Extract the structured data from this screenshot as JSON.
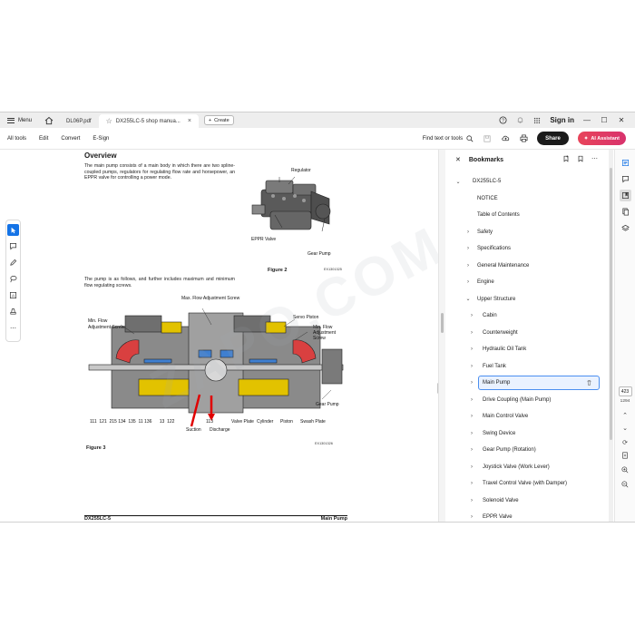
{
  "titlebar": {
    "menu_label": "Menu",
    "tabs": [
      {
        "label": "DL06P.pdf"
      },
      {
        "label": "DX255LC-5 shop manua...",
        "close": "×"
      }
    ],
    "create_label": "Create",
    "sign_in": "Sign in"
  },
  "toolbar": {
    "items": [
      "All tools",
      "Edit",
      "Convert",
      "E-Sign"
    ],
    "find_label": "Find text or tools",
    "share_label": "Share",
    "ai_label": "AI Assistant"
  },
  "document": {
    "title": "Overview",
    "overview_text": "The main pump consists of a main body in which there are two spline-coupled pumps, regulators for regulating flow rate and horsepower, an EPPR valve for controlling a power mode.",
    "pump_text": "The pump is as follows, and further includes maximum and minimum flow regulating screws.",
    "fig2": {
      "regulator": "Regulator",
      "eppr_valve": "EPPR Valve",
      "gear_pump": "Gear Pump",
      "caption": "Figure 2",
      "code": "EX1301325"
    },
    "fig3": {
      "max_flow": "Max. Flow Adjustment Screw",
      "min_flow_left_1": "Min. Flow",
      "min_flow_left_2": "Adjustment Screw",
      "servo_piston": "Servo Piston",
      "min_flow_right_1": "Min. Flow",
      "min_flow_right_2": "Adjustment",
      "min_flow_right_3": "Screw",
      "gear_pump": "Gear Pump",
      "numbers": "111  121  215 134  135  11 136      13  122",
      "num_113": "113",
      "valve_plate": "Valve Plate",
      "cylinder": "Cylinder",
      "piston": "Piston",
      "swash_plate": "Swash Plate",
      "suction": "Suction",
      "discharge": "Discharge",
      "caption": "Figure 3",
      "code": "EX1301326"
    },
    "footer_left": "DX255LC-5",
    "footer_right": "Main Pump",
    "watermark": "ZAPO.COM"
  },
  "bookmarks": {
    "header": "Bookmarks",
    "items": [
      {
        "label": "DX255LC-5",
        "level": 0,
        "chev": "⌄"
      },
      {
        "label": "NOTICE",
        "level": 1,
        "chev": ""
      },
      {
        "label": "Table of Contents",
        "level": 1,
        "chev": ""
      },
      {
        "label": "Safety",
        "level": 1,
        "chev": "›"
      },
      {
        "label": "Specifications",
        "level": 1,
        "chev": "›"
      },
      {
        "label": "General Maintenance",
        "level": 1,
        "chev": "›"
      },
      {
        "label": "Engine",
        "level": 1,
        "chev": "›"
      },
      {
        "label": "Upper Structure",
        "level": 1,
        "chev": "⌄"
      },
      {
        "label": "Cabin",
        "level": 2,
        "chev": "›"
      },
      {
        "label": "Counterweight",
        "level": 2,
        "chev": "›"
      },
      {
        "label": "Hydraulic Oil Tank",
        "level": 2,
        "chev": "›"
      },
      {
        "label": "Fuel Tank",
        "level": 2,
        "chev": "›"
      },
      {
        "label": "Main Pump",
        "level": 2,
        "chev": "›",
        "selected": true
      },
      {
        "label": "Drive Coupling (Main Pump)",
        "level": 2,
        "chev": "›"
      },
      {
        "label": "Main Control Valve",
        "level": 2,
        "chev": "›"
      },
      {
        "label": "Swing Device",
        "level": 2,
        "chev": "›"
      },
      {
        "label": "Gear Pump (Rotation)",
        "level": 2,
        "chev": "›"
      },
      {
        "label": "Joystick Valve (Work Lever)",
        "level": 2,
        "chev": "›"
      },
      {
        "label": "Travel Control Valve (with Damper)",
        "level": 2,
        "chev": "›"
      },
      {
        "label": "Solenoid Valve",
        "level": 2,
        "chev": "›"
      },
      {
        "label": "EPPR Valve",
        "level": 2,
        "chev": "›"
      }
    ]
  },
  "page_nav": {
    "current": "423",
    "total": "1294"
  },
  "colors": {
    "accent": "#1473e6",
    "ai_button": "#e0405f",
    "share_button": "#1b1b1b",
    "selected_bookmark_border": "#4b8ff0"
  }
}
